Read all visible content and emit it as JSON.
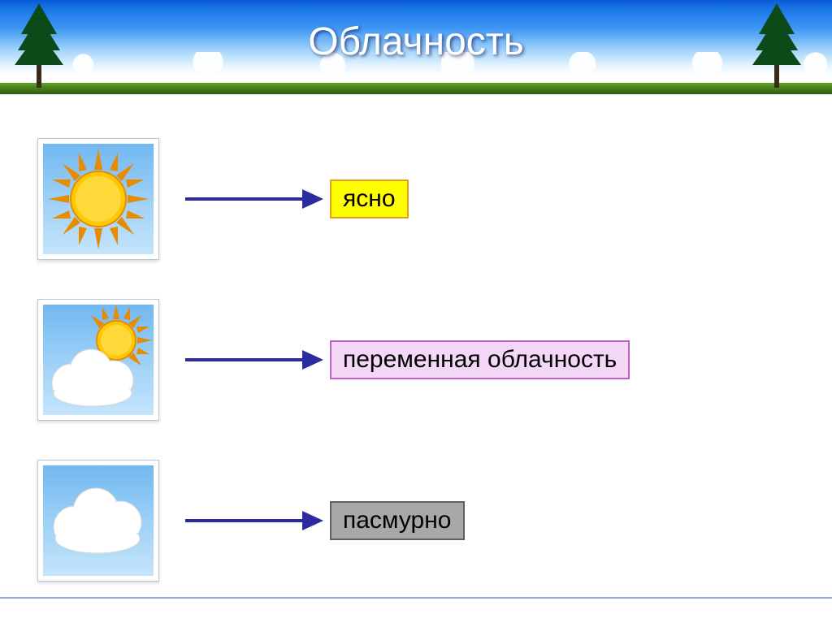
{
  "title": "Облачность",
  "rows": [
    {
      "label": "ясно",
      "icon": "sun-icon",
      "style": "clear"
    },
    {
      "label": "переменная облачность",
      "icon": "partly-cloudy-icon",
      "style": "partly"
    },
    {
      "label": "пасмурно",
      "icon": "overcast-icon",
      "style": "overcast"
    }
  ],
  "colors": {
    "sky_top": "#0a5bd6",
    "arrow": "#2c2aa0",
    "clear_bg": "#ffff00",
    "partly_bg": "#f4d6f6",
    "overcast_bg": "#a8a8a8"
  }
}
